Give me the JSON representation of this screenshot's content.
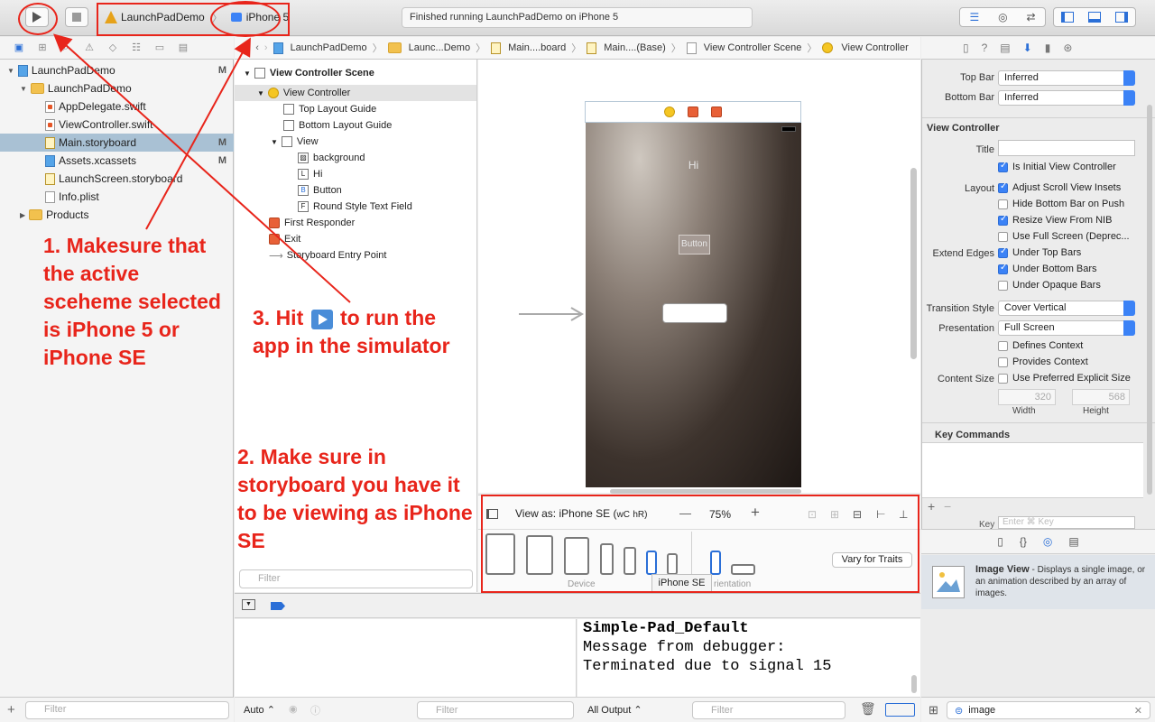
{
  "toolbar": {
    "scheme_name": "LaunchPadDemo",
    "device_name": "iPhone 5",
    "status_text": "Finished running LaunchPadDemo on iPhone 5"
  },
  "jumpbar": {
    "crumbs": [
      "LaunchPadDemo",
      "Launc...Demo",
      "Main....board",
      "Main....(Base)",
      "View Controller Scene",
      "View Controller"
    ]
  },
  "navigator": {
    "items": [
      {
        "label": "LaunchPadDemo",
        "badge": "M"
      },
      {
        "label": "LaunchPadDemo",
        "badge": "M"
      },
      {
        "label": "AppDelegate.swift",
        "badge": ""
      },
      {
        "label": "ViewController.swift",
        "badge": ""
      },
      {
        "label": "Main.storyboard",
        "badge": "M"
      },
      {
        "label": "Assets.xcassets",
        "badge": "M"
      },
      {
        "label": "LaunchScreen.storyboard",
        "badge": ""
      },
      {
        "label": "Info.plist",
        "badge": ""
      },
      {
        "label": "Products",
        "badge": ""
      }
    ],
    "filter_placeholder": "Filter"
  },
  "outline": {
    "items": [
      {
        "label": "View Controller Scene"
      },
      {
        "label": "View Controller"
      },
      {
        "label": "Top Layout Guide"
      },
      {
        "label": "Bottom Layout Guide"
      },
      {
        "label": "View"
      },
      {
        "label": "background"
      },
      {
        "label": "Hi",
        "glyph": "L"
      },
      {
        "label": "Button",
        "glyph": "B"
      },
      {
        "label": "Round Style Text Field",
        "glyph": "F"
      },
      {
        "label": "First Responder"
      },
      {
        "label": "Exit"
      },
      {
        "label": "Storyboard Entry Point"
      }
    ],
    "filter_placeholder": "Filter"
  },
  "canvas": {
    "hi_label": "Hi",
    "button_label": "Button"
  },
  "devicebar": {
    "view_as": "View as: iPhone SE",
    "size_class_w": "wC",
    "size_class_h": "hR)",
    "zoom": "75%",
    "zoom_minus": "—",
    "zoom_plus": "+",
    "device_caption": "Device",
    "orientation_caption": "rientation",
    "vary_button": "Vary for Traits",
    "tooltip": "iPhone SE"
  },
  "debug": {
    "console_lines": [
      "Simple-Pad_Default",
      "Message from debugger:",
      "Terminated due to signal 15"
    ],
    "auto_label": "Auto",
    "output_label": "All Output",
    "filter_placeholder": "Filter"
  },
  "inspector": {
    "top_bar_label": "Top Bar",
    "top_bar_value": "Inferred",
    "bottom_bar_label": "Bottom Bar",
    "bottom_bar_value": "Inferred",
    "section_vc": "View Controller",
    "title_label": "Title",
    "is_initial": "Is Initial View Controller",
    "layout_label": "Layout",
    "adjust_scroll": "Adjust Scroll View Insets",
    "hide_bottom": "Hide Bottom Bar on Push",
    "resize_nib": "Resize View From NIB",
    "full_screen": "Use Full Screen (Deprec...",
    "extend_label": "Extend Edges",
    "under_top": "Under Top Bars",
    "under_bottom": "Under Bottom Bars",
    "under_opaque": "Under Opaque Bars",
    "transition_label": "Transition Style",
    "transition_value": "Cover Vertical",
    "presentation_label": "Presentation",
    "presentation_value": "Full Screen",
    "defines_context": "Defines Context",
    "provides_context": "Provides Context",
    "content_size_label": "Content Size",
    "preferred_size": "Use Preferred Explicit Size",
    "width_value": "320",
    "height_value": "568",
    "width_caption": "Width",
    "height_caption": "Height",
    "key_commands": "Key Commands",
    "key_label": "Key",
    "key_placeholder": "Enter ⌘ Key"
  },
  "library": {
    "item_title": "Image View",
    "item_desc": " - Displays a single image, or an animation described by an array of images.",
    "search_value": "image"
  },
  "annotations": {
    "note1": "1. Makesure that the active sceheme selected is iPhone 5 or iPhone SE",
    "note2": "2. Make sure in storyboard you have it to be viewing as iPhone SE",
    "note3_a": "3. Hit",
    "note3_b": "to run the app in the simulator",
    "accent_color": "#e8251b"
  }
}
